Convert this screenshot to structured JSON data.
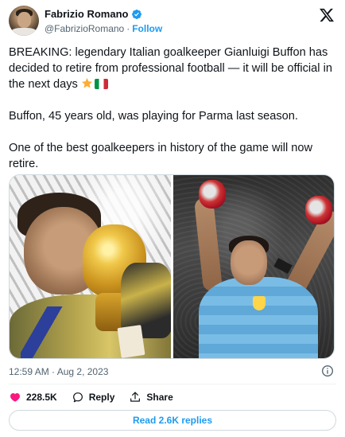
{
  "author": {
    "name": "Fabrizio Romano",
    "handle": "@FabrizioRomano",
    "separator": "·",
    "follow_label": "Follow"
  },
  "tweet": {
    "paragraph1": "BREAKING: legendary Italian goalkeeper Gianluigi Buffon has decided to retire from professional football — it will be official in the next days",
    "paragraph2": "Buffon, 45 years old, was playing for Parma last season.",
    "paragraph3": "One of the best goalkeepers in history of the game will now retire.",
    "emojis": [
      "star-emoji",
      "italy-flag-emoji"
    ],
    "timestamp": "12:59 AM · Aug 2, 2023"
  },
  "actions": {
    "like_count": "228.5K",
    "reply_label": "Reply",
    "share_label": "Share"
  },
  "replies_button": "Read 2.6K replies",
  "colors": {
    "accent": "#1d9bf0",
    "like": "#f91880",
    "text": "#0f1419",
    "secondary": "#536471"
  }
}
